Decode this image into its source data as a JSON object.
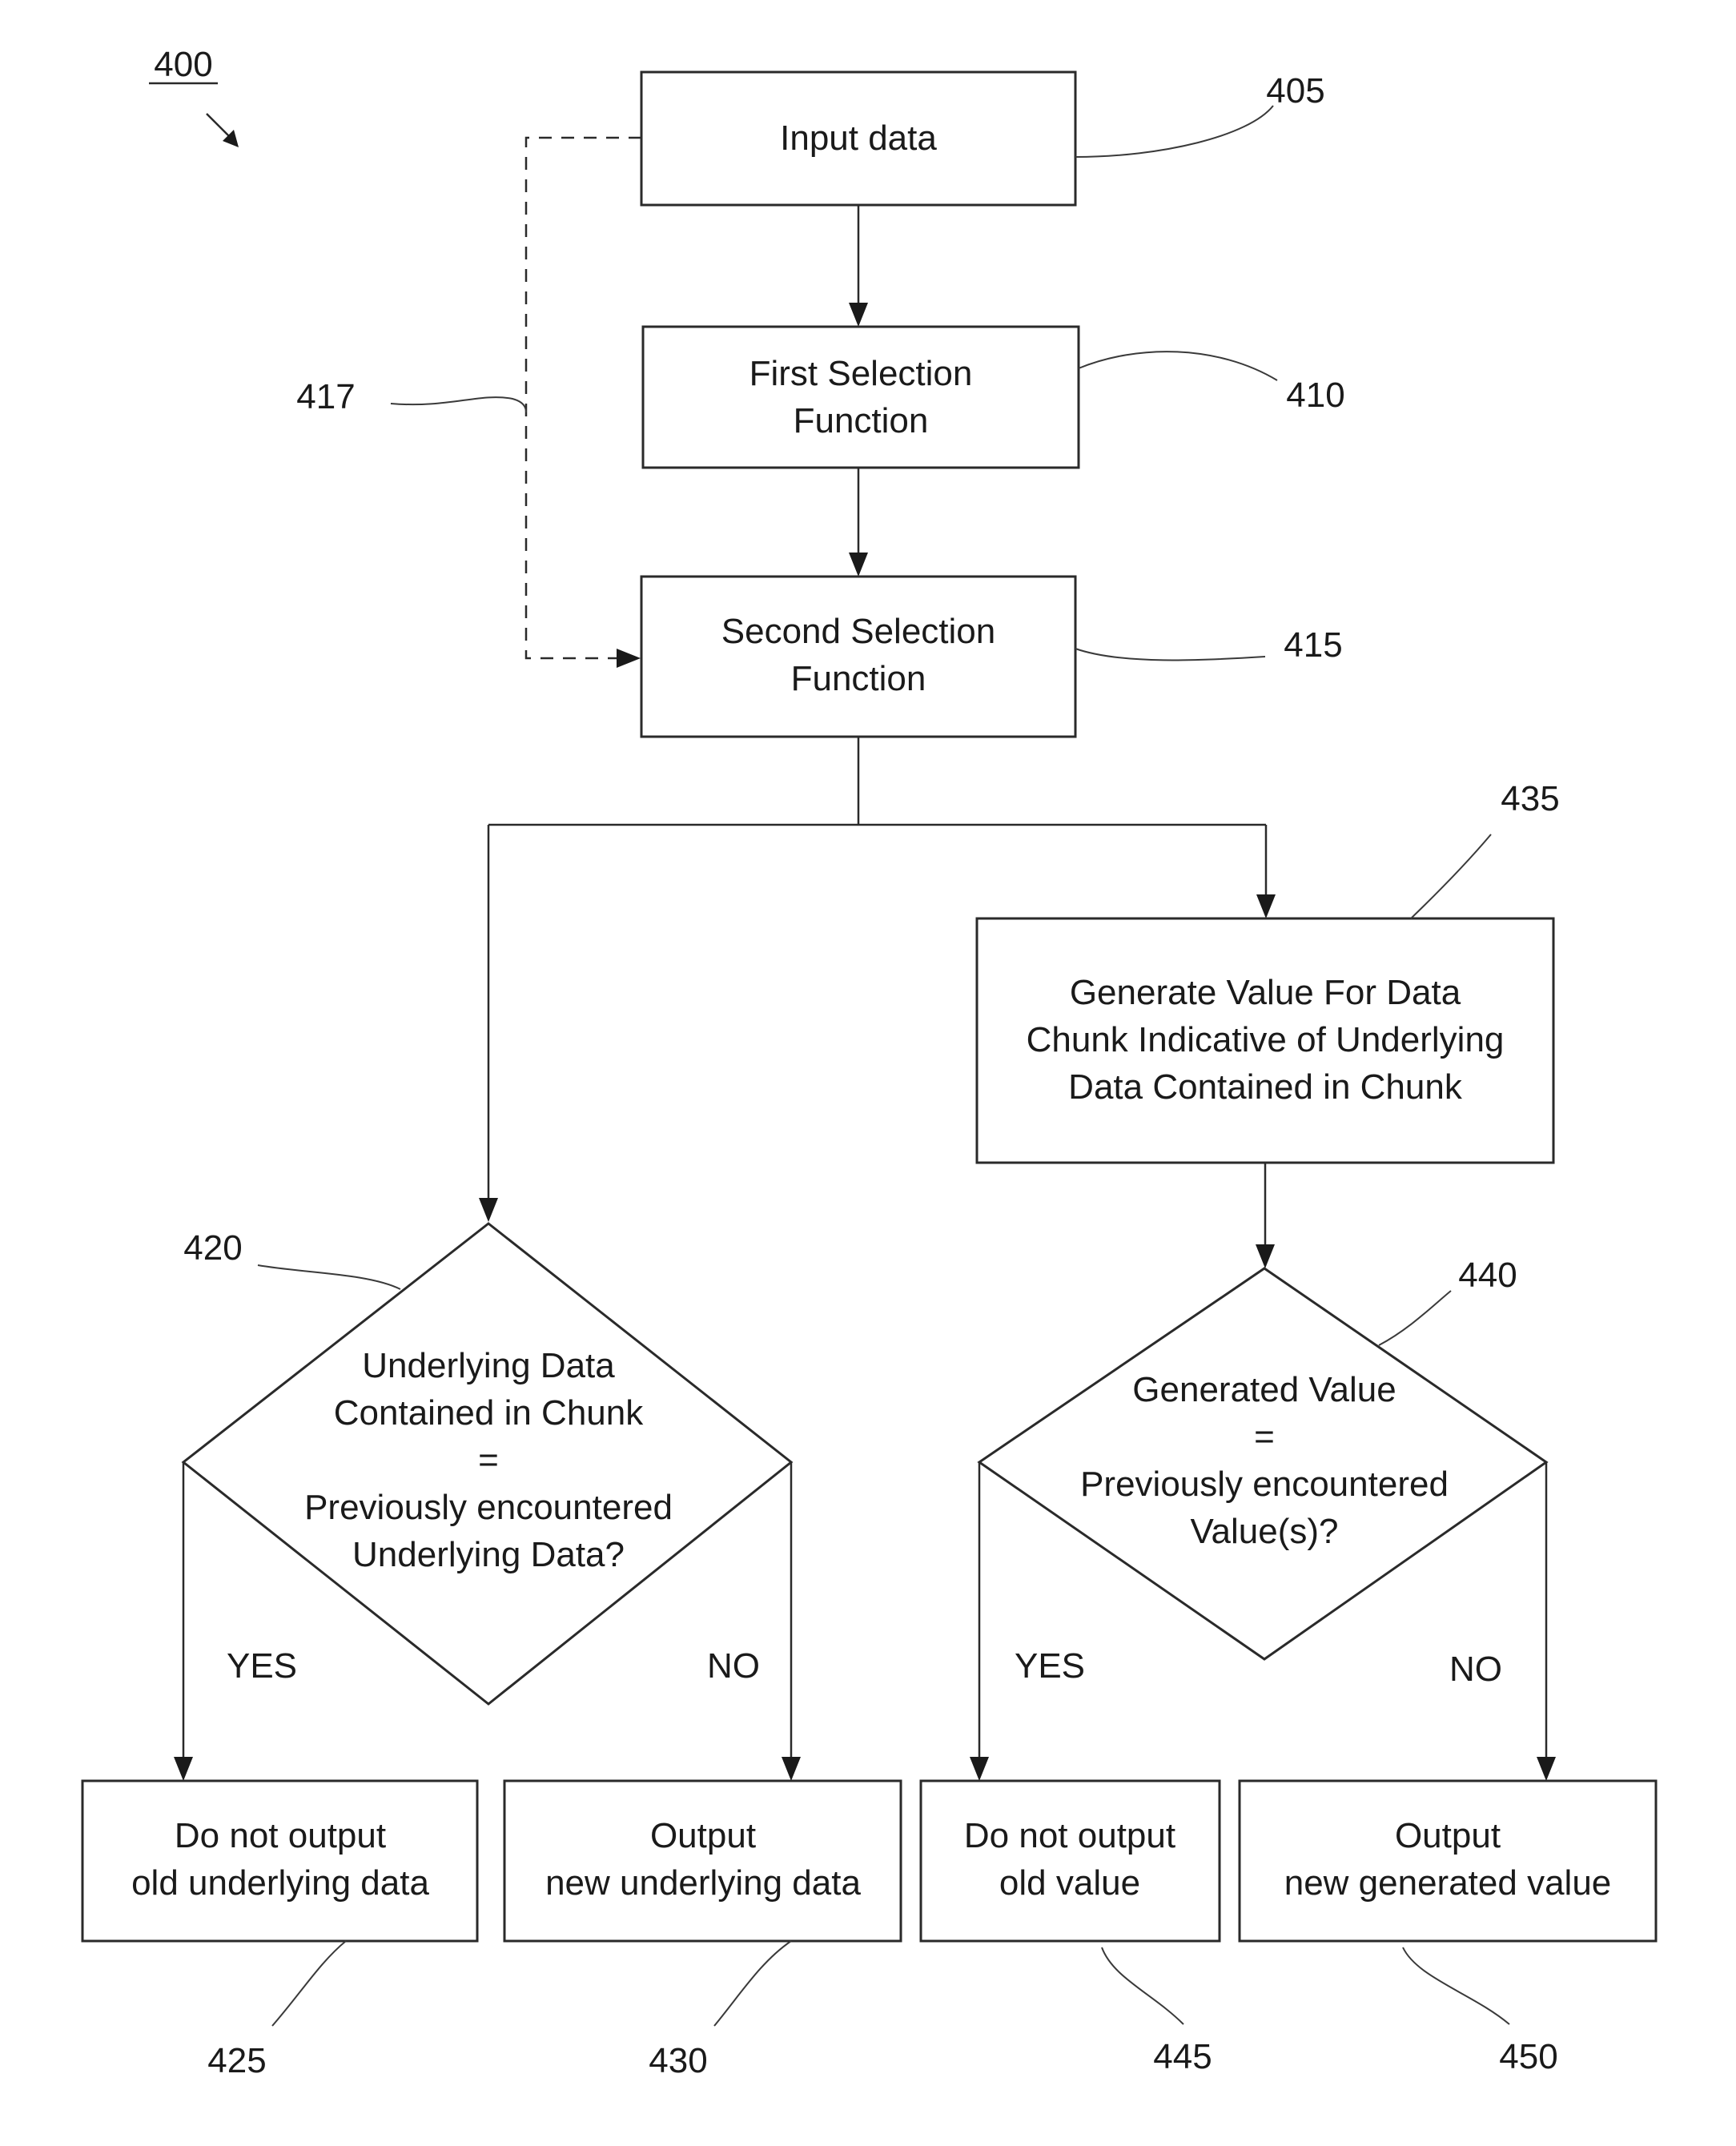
{
  "figure": {
    "number": "400"
  },
  "nodes": {
    "input": {
      "ref": "405",
      "lines": [
        "Input data"
      ]
    },
    "first_selection": {
      "ref": "410",
      "lines": [
        "First Selection",
        "Function"
      ]
    },
    "second_selection": {
      "ref": "415",
      "lines": [
        "Second Selection",
        "Function"
      ]
    },
    "bypass": {
      "ref": "417"
    },
    "decision_underlying": {
      "ref": "420",
      "lines": [
        "Underlying Data",
        "Contained in Chunk",
        "=",
        "Previously encountered",
        "Underlying Data?"
      ],
      "yes_label": "YES",
      "no_label": "NO"
    },
    "no_output_old_data": {
      "ref": "425",
      "lines": [
        "Do not output",
        "old underlying data"
      ]
    },
    "output_new_data": {
      "ref": "430",
      "lines": [
        "Output",
        "new underlying data"
      ]
    },
    "generate_value": {
      "ref": "435",
      "lines": [
        "Generate Value For Data",
        "Chunk Indicative of Underlying",
        "Data Contained in Chunk"
      ]
    },
    "decision_value": {
      "ref": "440",
      "lines": [
        "Generated Value",
        "=",
        "Previously encountered",
        "Value(s)?"
      ],
      "yes_label": "YES",
      "no_label": "NO"
    },
    "no_output_old_value": {
      "ref": "445",
      "lines": [
        "Do not output",
        "old value"
      ]
    },
    "output_new_value": {
      "ref": "450",
      "lines": [
        "Output",
        "new generated value"
      ]
    }
  }
}
